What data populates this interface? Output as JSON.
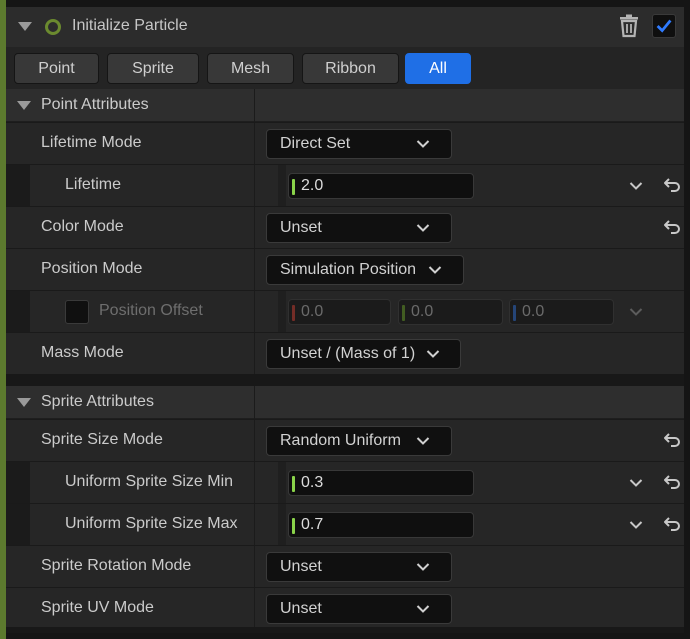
{
  "header": {
    "title": "Initialize Particle",
    "icons": [
      "collapse-caret-icon",
      "module-ring-icon",
      "trash-icon",
      "checkmark-icon"
    ],
    "enabled": true
  },
  "tabs": [
    {
      "label": "Point",
      "active": false
    },
    {
      "label": "Sprite",
      "active": false
    },
    {
      "label": "Mesh",
      "active": false
    },
    {
      "label": "Ribbon",
      "active": false
    },
    {
      "label": "All",
      "active": true
    }
  ],
  "point_attributes": {
    "title": "Point Attributes",
    "lifetime_mode": {
      "label": "Lifetime Mode",
      "value": "Direct Set"
    },
    "lifetime": {
      "label": "Lifetime",
      "value": "2.0"
    },
    "color_mode": {
      "label": "Color Mode",
      "value": "Unset"
    },
    "position_mode": {
      "label": "Position Mode",
      "value": "Simulation Position"
    },
    "position_offset": {
      "label": "Position Offset",
      "x": "0.0",
      "y": "0.0",
      "z": "0.0"
    },
    "mass_mode": {
      "label": "Mass Mode",
      "value": "Unset / (Mass of 1)"
    }
  },
  "sprite_attributes": {
    "title": "Sprite Attributes",
    "sprite_size_mode": {
      "label": "Sprite Size Mode",
      "value": "Random Uniform"
    },
    "size_min": {
      "label": "Uniform Sprite Size Min",
      "value": "0.3"
    },
    "size_max": {
      "label": "Uniform Sprite Size Max",
      "value": "0.7"
    },
    "rotation_mode": {
      "label": "Sprite Rotation Mode",
      "value": "Unset"
    },
    "uv_mode": {
      "label": "Sprite UV Mode",
      "value": "Unset"
    }
  },
  "colors": {
    "accent_green": "#6b8a2f",
    "active_tab": "#1f6fe6",
    "axis_x": "#b03a30",
    "axis_y": "#5e8a28",
    "axis_z": "#2d63b8",
    "value_tick": "#8ad34a"
  }
}
